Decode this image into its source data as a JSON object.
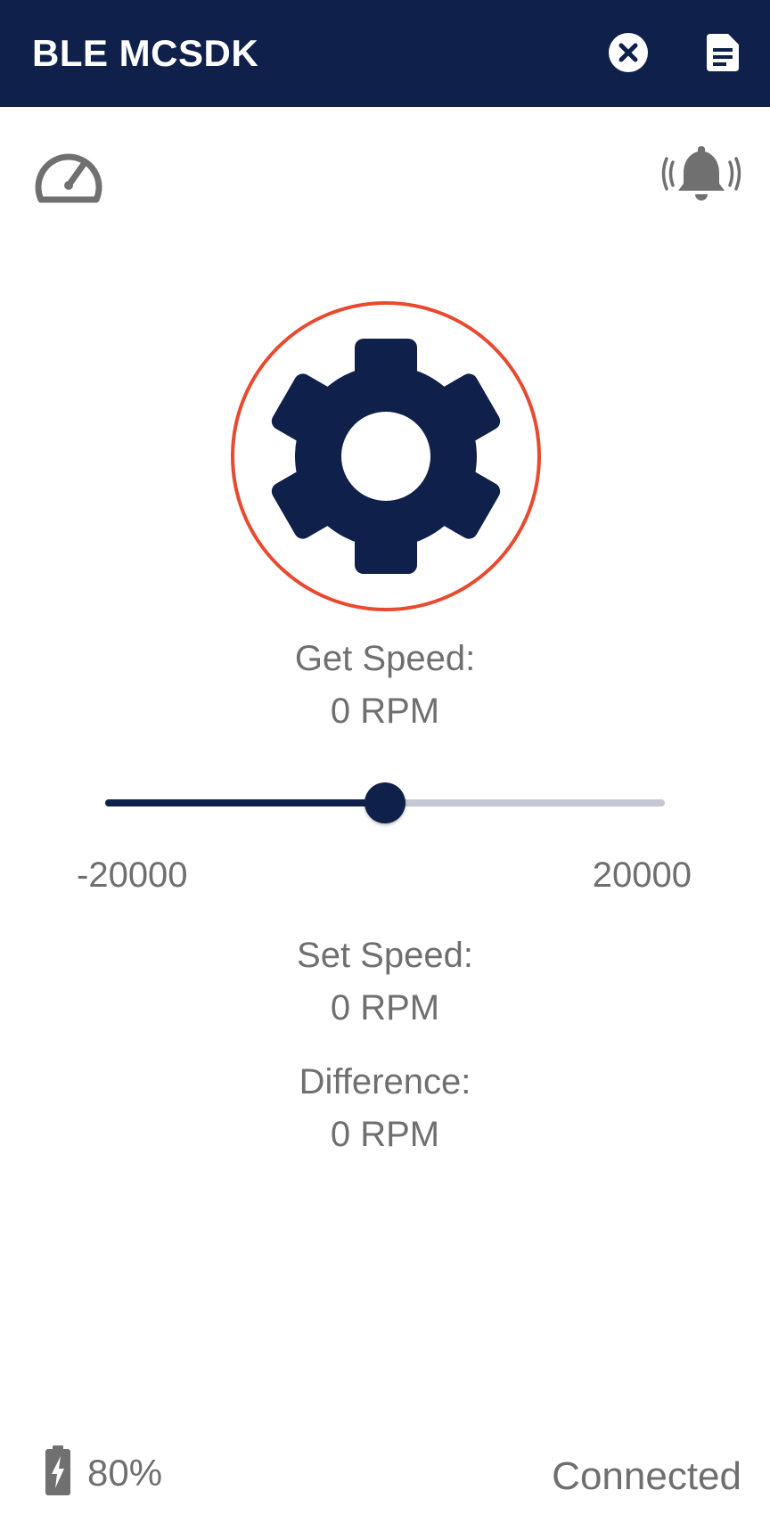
{
  "app_bar": {
    "title": "BLE MCSDK",
    "background_color": "#0f214b",
    "actions": [
      {
        "icon": "close-circle-icon"
      },
      {
        "icon": "document-icon"
      }
    ]
  },
  "toolbar_icons": {
    "left": "speedometer-icon",
    "right": "alarm-bell-icon"
  },
  "motor": {
    "icon": "gear-icon",
    "ring_color": "#e8492f",
    "gear_color": "#0f214b"
  },
  "get_speed": {
    "label": "Get Speed:",
    "value": "0 RPM"
  },
  "speed_slider": {
    "min_label": "-20000",
    "max_label": "20000",
    "min": -20000,
    "max": 20000,
    "value": 0,
    "accent_color": "#0f214b"
  },
  "set_speed": {
    "label": "Set Speed:",
    "value": "0 RPM"
  },
  "difference": {
    "label": "Difference:",
    "value": "0 RPM"
  },
  "footer": {
    "battery_icon": "battery-charging-icon",
    "battery_level": "80%",
    "connection_status": "Connected"
  }
}
